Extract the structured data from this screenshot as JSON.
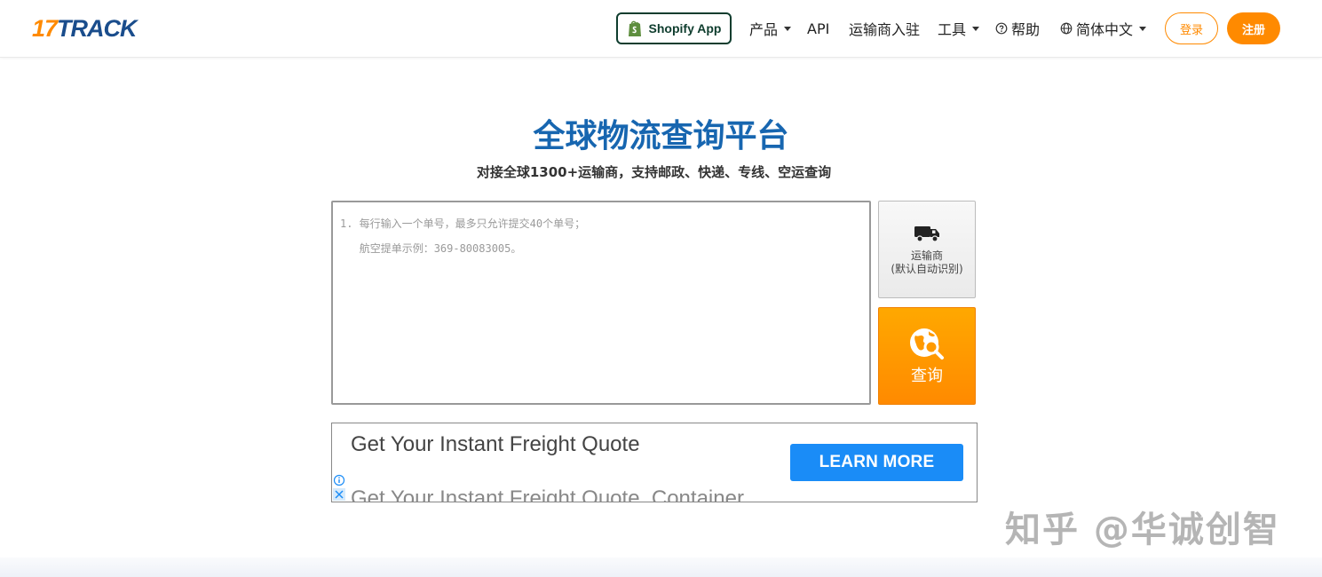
{
  "header": {
    "logo_num": "17",
    "logo_word": "TRACK",
    "shopify_label": "Shopify App",
    "nav": {
      "products": "产品",
      "api": "API",
      "carrier_join": "运输商入驻",
      "tools": "工具",
      "help": "帮助",
      "language": "简体中文"
    },
    "login": "登录",
    "register": "注册"
  },
  "hero": {
    "title": "全球物流查询平台",
    "subtitle": "对接全球1300+运输商，支持邮政、快递、专线、空运查询"
  },
  "tracking": {
    "placeholder": "1. 每行输入一个单号，最多只允许提交40个单号；\n   航空提单示例：369-80083005。",
    "carrier_label": "运输商",
    "carrier_hint": "(默认自动识别)",
    "search_label": "查询"
  },
  "ad": {
    "headline": "Get Your Instant Freight Quote",
    "secondary": "Get Your Instant Freight Quote, Container",
    "cta": "LEARN MORE"
  },
  "watermark": "知乎 @华诚创智",
  "colors": {
    "brand_orange": "#ff8a00",
    "brand_blue": "#1766b0",
    "ad_blue": "#1a8cf7"
  },
  "icons": [
    "shopify-icon",
    "help-circle-icon",
    "globe-icon",
    "truck-icon",
    "globe-search-icon",
    "ad-info-icon",
    "ad-close-icon"
  ]
}
